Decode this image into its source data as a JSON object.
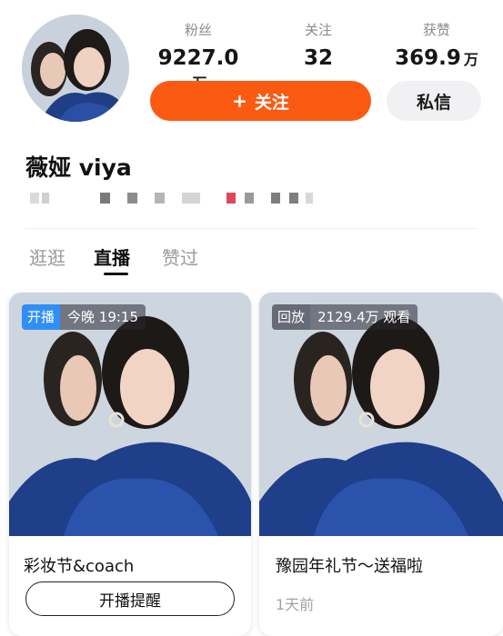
{
  "profile": {
    "name": "薇娅 viya",
    "stats": {
      "fans": {
        "label": "粉丝",
        "value": "9227.0",
        "unit": "万"
      },
      "following": {
        "label": "关注",
        "value": "32"
      },
      "likes": {
        "label": "获赞",
        "value": "369.9",
        "unit": "万"
      }
    },
    "follow_label": "关注",
    "message_label": "私信",
    "colors": {
      "follow_button": "#fb5a13",
      "live_tag": "#2f8ff7"
    }
  },
  "tabs": [
    {
      "label": "逛逛",
      "active": false
    },
    {
      "label": "直播",
      "active": true
    },
    {
      "label": "赞过",
      "active": false
    }
  ],
  "cards": [
    {
      "tag": "开播",
      "info": "今晚 19:15",
      "title": "彩妆节&coach",
      "action_label": "开播提醒"
    },
    {
      "tag": "回放",
      "info": "2129.4万 观看",
      "title": "豫园年礼节～送福啦",
      "time": "1天前"
    }
  ]
}
